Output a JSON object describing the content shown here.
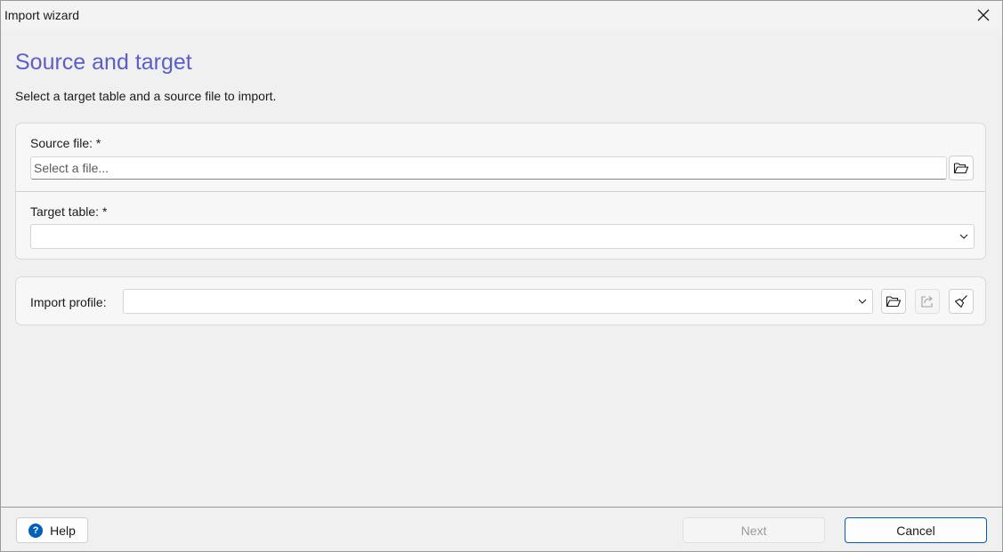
{
  "window": {
    "title": "Import wizard"
  },
  "page": {
    "heading": "Source and target",
    "subtitle": "Select a target table and a source file to import."
  },
  "source": {
    "label": "Source file: *",
    "value": "",
    "placeholder": "Select a file..."
  },
  "target": {
    "label": "Target table: *",
    "selected": ""
  },
  "profile": {
    "label": "Import profile:",
    "selected": ""
  },
  "footer": {
    "help_label": "Help",
    "help_glyph": "?",
    "next_label": "Next",
    "cancel_label": "Cancel"
  },
  "colors": {
    "heading": "#5b5fc7",
    "accent": "#005fb8",
    "disabled_text": "#9a9a9a"
  },
  "icons": {
    "close": "close-icon",
    "browse": "folder-open-icon",
    "export": "share-icon",
    "clear": "broom-icon",
    "dropdown": "chevron-down-icon",
    "help": "help-icon"
  }
}
